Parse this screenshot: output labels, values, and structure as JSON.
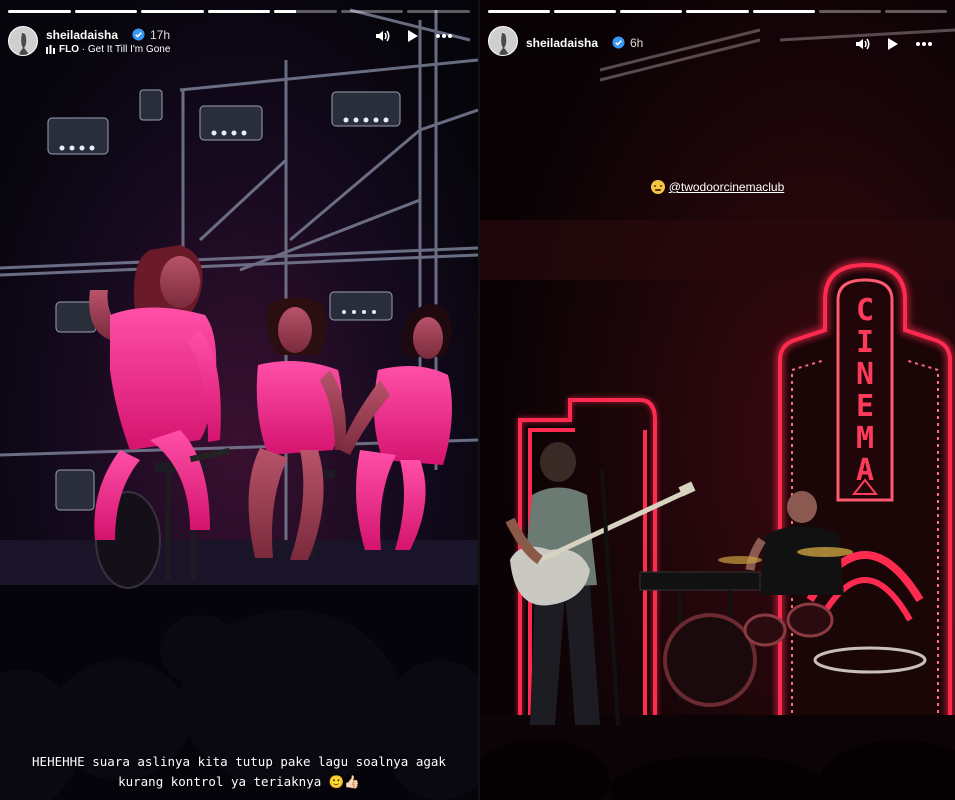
{
  "stories": [
    {
      "username": "sheiladaisha",
      "time": "17h",
      "music_artist": "FLO",
      "music_track": "Get It Till I'm Gone",
      "progress": [
        1,
        1,
        1,
        1,
        0.35,
        0,
        0
      ],
      "caption_line1": "HEHEHHE suara aslinya kita tutup pake lagu soalnya agak",
      "caption_line2": "kurang kontrol ya teriaknya 🙂👍🏻",
      "icons": [
        "volume-icon",
        "play-icon",
        "more-icon"
      ]
    },
    {
      "username": "sheiladaisha",
      "time": "6h",
      "mention": "@twodoorcinemaclub",
      "progress": [
        1,
        1,
        1,
        1,
        1,
        0,
        0
      ],
      "sign_text": "CINEMA",
      "icons": [
        "volume-icon",
        "play-icon",
        "more-icon"
      ]
    }
  ],
  "colors": {
    "neon": "#ff2a4f",
    "pink": "#ff2a8a",
    "verified": "#3897f0"
  }
}
